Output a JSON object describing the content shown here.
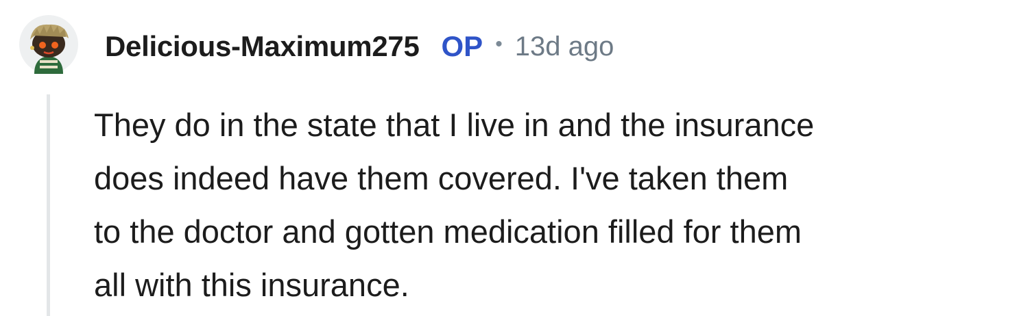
{
  "comment": {
    "author": {
      "username": "Delicious-Maximum275",
      "op_badge": "OP",
      "avatar_icon": "snoo-avatar-icon"
    },
    "separator": "•",
    "timestamp": "13d ago",
    "body_lines": [
      "They do in the state that I live in and the insurance",
      "does indeed have them covered. I've taken them",
      "to the doctor and gotten medication filled for them",
      "all with this insurance."
    ]
  },
  "colors": {
    "username": "#1c1c1c",
    "op_badge": "#2f54c8",
    "timestamp": "#6d7a86",
    "thread_line": "#e3e6e8"
  }
}
